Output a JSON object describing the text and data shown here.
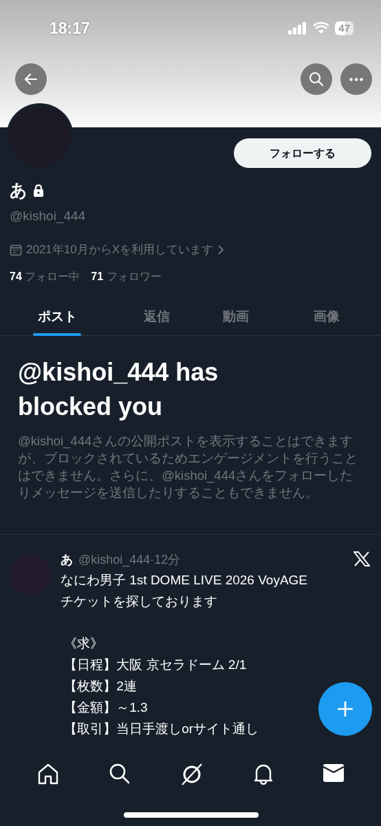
{
  "status_bar": {
    "time": "18:17",
    "battery": "47"
  },
  "profile": {
    "name": "あ",
    "locked": true,
    "handle": "@kishoi_444",
    "joined": "2021年10月からXを利用しています",
    "following_count": "74",
    "following_label": "フォロー中",
    "followers_count": "71",
    "followers_label": "フォロワー",
    "follow_button": "フォローする"
  },
  "tabs": [
    {
      "label": "ポスト",
      "selected": true
    },
    {
      "label": "返信",
      "selected": false
    },
    {
      "label": "動画",
      "selected": false
    },
    {
      "label": "画像",
      "selected": false
    }
  ],
  "blocked_notice": {
    "title": "@kishoi_444 has blocked you",
    "body": "@kishoi_444さんの公開ポストを表示することはできますが、ブロックされているためエンゲージメントを行うことはできません。さらに、@kishoi_444さんをフォローしたりメッセージを送信したりすることもできません。"
  },
  "post": {
    "name": "あ",
    "handle": "@kishoi_444",
    "time": "·12分",
    "paragraphs": [
      [
        "なにわ男子 1st DOME LIVE 2026 VoyAGE",
        "チケットを探しております"
      ],
      [
        " 《求》",
        " 【日程】大阪 京セラドーム 2/1",
        " 【枚数】2連",
        " 【金額】～1.3",
        " 【取引】当日手渡しorサイト通し"
      ]
    ]
  }
}
